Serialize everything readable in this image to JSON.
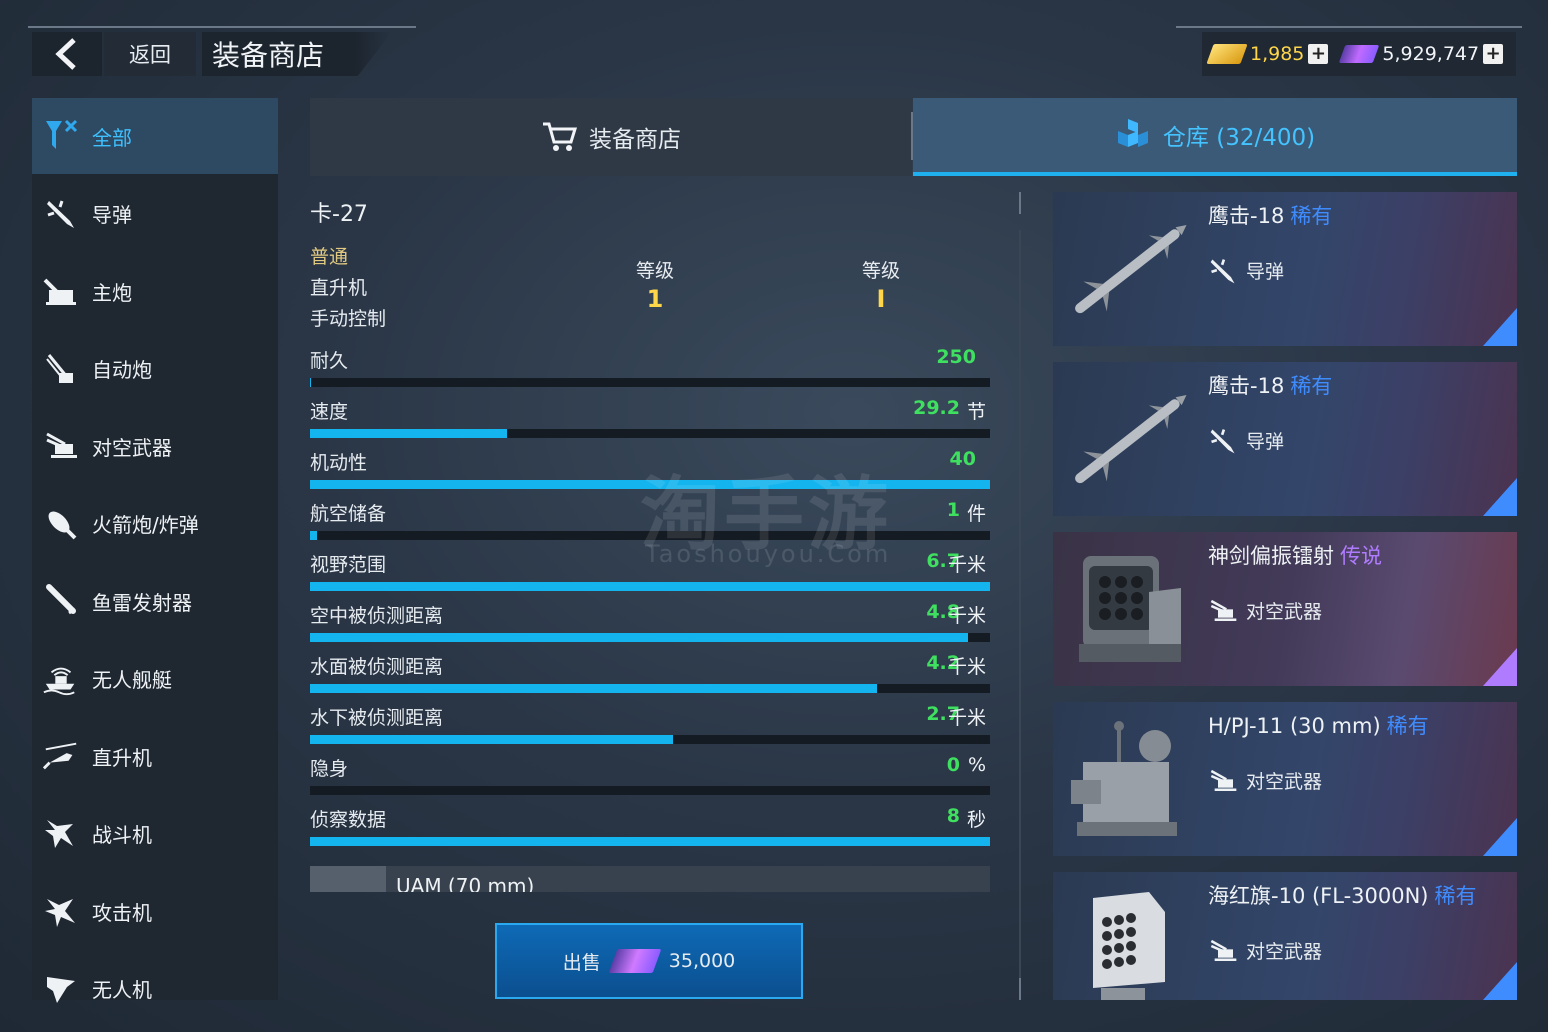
{
  "header": {
    "back_label": "返回",
    "title": "装备商店",
    "gold": "1,985",
    "gems": "5,929,747"
  },
  "sidebar": {
    "items": [
      {
        "label": "全部",
        "icon": "all-filter-icon"
      },
      {
        "label": "导弹",
        "icon": "missile-icon"
      },
      {
        "label": "主炮",
        "icon": "main-gun-icon"
      },
      {
        "label": "自动炮",
        "icon": "autocannon-icon"
      },
      {
        "label": "对空武器",
        "icon": "anti-air-icon"
      },
      {
        "label": "火箭炮/炸弹",
        "icon": "rocket-bomb-icon"
      },
      {
        "label": "鱼雷发射器",
        "icon": "torpedo-icon"
      },
      {
        "label": "无人舰艇",
        "icon": "drone-boat-icon"
      },
      {
        "label": "直升机",
        "icon": "helicopter-icon"
      },
      {
        "label": "战斗机",
        "icon": "fighter-icon"
      },
      {
        "label": "攻击机",
        "icon": "attacker-icon"
      },
      {
        "label": "无人机",
        "icon": "drone-icon"
      }
    ]
  },
  "tabs": {
    "shop": "装备商店",
    "warehouse": "仓库 (32/400)"
  },
  "detail": {
    "name": "卡-27",
    "rarity": "普通",
    "type": "直升机",
    "control": "手动控制",
    "level_label_1": "等级",
    "level_value_1": "1",
    "level_label_2": "等级",
    "level_value_2": "I",
    "stats": [
      {
        "name": "耐久",
        "value": "250",
        "unit": "",
        "fill": 0.002
      },
      {
        "name": "速度",
        "value": "29.2",
        "unit": "节",
        "fill": 0.29
      },
      {
        "name": "机动性",
        "value": "40",
        "unit": "",
        "fill": 1.0
      },
      {
        "name": "航空储备",
        "value": "1",
        "unit": "件",
        "fill": 0.01
      },
      {
        "name": "视野范围",
        "value": "6.7",
        "unit": "千米",
        "fill": 1.0
      },
      {
        "name": "空中被侦测距离",
        "value": "4.8",
        "unit": "千米",
        "fill": 0.967
      },
      {
        "name": "水面被侦测距离",
        "value": "4.2",
        "unit": "千米",
        "fill": 0.834
      },
      {
        "name": "水下被侦测距离",
        "value": "2.7",
        "unit": "千米",
        "fill": 0.534
      },
      {
        "name": "隐身",
        "value": "0",
        "unit": "%",
        "fill": 0
      },
      {
        "name": "侦察数据",
        "value": "8",
        "unit": "秒",
        "fill": 1.0
      }
    ],
    "equip_name": "UAM (70 mm)",
    "sell_label": "出售",
    "sell_price": "35,000"
  },
  "watermark": {
    "main": "淘手游",
    "sub": "Taoshouyou.Com"
  },
  "inventory": [
    {
      "name": "鹰击-18",
      "rarity": "稀有",
      "rarity_color": "#3f8cff",
      "type": "导弹",
      "type_icon": "missile-icon",
      "image": "missile-image"
    },
    {
      "name": "鹰击-18",
      "rarity": "稀有",
      "rarity_color": "#3f8cff",
      "type": "导弹",
      "type_icon": "missile-icon",
      "image": "missile-image"
    },
    {
      "name": "神剑偏振镭射",
      "rarity": "传说",
      "rarity_color": "#b07cff",
      "type": "对空武器",
      "type_icon": "anti-air-icon",
      "image": "laser-turret-image"
    },
    {
      "name": "H/PJ-11 (30 mm)",
      "rarity": "稀有",
      "rarity_color": "#3f8cff",
      "type": "对空武器",
      "type_icon": "anti-air-icon",
      "image": "ciws-turret-image"
    },
    {
      "name": "海红旗-10 (FL-3000N)",
      "rarity": "稀有",
      "rarity_color": "#3f8cff",
      "type": "对空武器",
      "type_icon": "anti-air-icon",
      "image": "launcher-image"
    }
  ],
  "colors": {
    "accent_blue": "#14b4ee",
    "value_green": "#3fe060",
    "gold": "#ffd54a",
    "rare_blue": "#3f8cff",
    "legend_purple": "#b07cff"
  }
}
